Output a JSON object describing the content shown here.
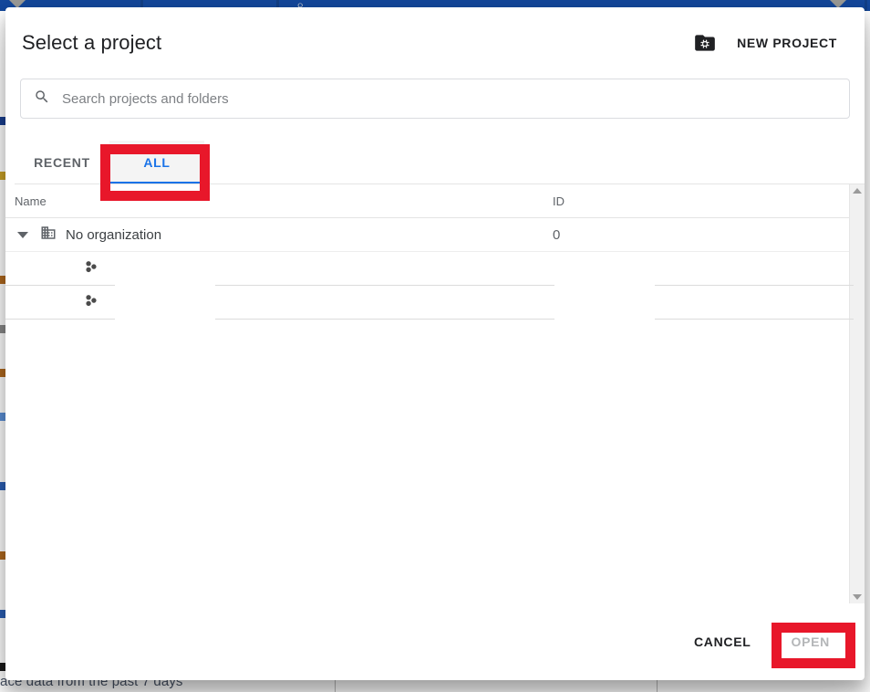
{
  "background": {
    "bottom_text": "ace data from the past 7 days",
    "topbar_color": "#14489c",
    "search_glyph": "⌕"
  },
  "dialog": {
    "title": "Select a project",
    "new_project": {
      "icon": "create-new-folder-icon",
      "label": "NEW PROJECT"
    },
    "search": {
      "icon": "search-icon",
      "placeholder": "Search projects and folders",
      "value": ""
    },
    "tabs": [
      {
        "id": "recent",
        "label": "RECENT",
        "active": false
      },
      {
        "id": "all",
        "label": "ALL",
        "active": true
      }
    ],
    "table": {
      "columns": [
        {
          "key": "name",
          "label": "Name"
        },
        {
          "key": "id",
          "label": "ID"
        }
      ],
      "rows": [
        {
          "type": "organization",
          "expander_icon": "caret-down-icon",
          "row_icon": "organization-building-icon",
          "name": "No organization",
          "id": "0"
        },
        {
          "type": "loading",
          "row_icon": "project-cluster-icon",
          "name": "",
          "id": ""
        },
        {
          "type": "loading",
          "row_icon": "project-cluster-icon",
          "name": "",
          "id": ""
        }
      ]
    },
    "scrollbar": {
      "up_icon": "scroll-up-arrow-icon",
      "down_icon": "scroll-down-arrow-icon"
    },
    "footer": {
      "cancel_label": "CANCEL",
      "open_label": "OPEN",
      "open_disabled": true
    }
  },
  "annotations": {
    "color": "#e8172a",
    "targets": [
      "all-tab",
      "open-button"
    ]
  },
  "colors": {
    "accent_blue": "#1a73e8",
    "header_blue": "#14489c",
    "annotation_red": "#e8172a",
    "text_primary": "#202124",
    "text_secondary": "#5f6368",
    "disabled": "#b4b6b8"
  }
}
